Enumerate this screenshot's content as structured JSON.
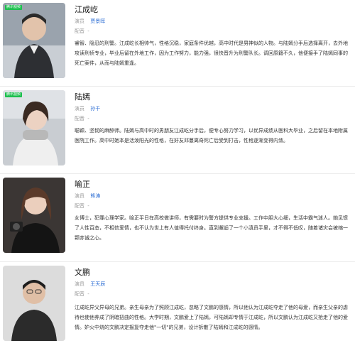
{
  "badge_label": "腾讯视频",
  "characters": [
    {
      "name": "江成屹",
      "actor_label": "演员",
      "actor": "贾景晖",
      "dub_label": "配音",
      "dub": "-",
      "description": "睿智、隐忍的刑警。江成屹长相帅气，性格沉稳，家庭条件优越，高中时代是男神似的人物。与陆嫣分手后选择离开，去外地攻读刑侦专业，毕业后留在外地工作，因为工作努力，能力强，很快晋升为刑警队长。调回原籍不久，他便接手了陆嫣同事的死亡案件，从而与陆嫣重逢。"
    },
    {
      "name": "陆嫣",
      "actor_label": "演员",
      "actor": "孙千",
      "dub_label": "配音",
      "dub": "-",
      "description": "聪颖、坚韧的麻醉师。陆嫣与高中时的男朋友江成屹分手后，便专心努力学习，以优异成绩从医科大毕业，之后留在本地附属医院工作。高中时她本是活泼阳光的性格，在好友邓蔓离奇死亡后受到打击，性格逐渐变得内敛。"
    },
    {
      "name": "喻正",
      "actor_label": "演员",
      "actor": "熊涛",
      "dub_label": "配音",
      "dub": "-",
      "description": "女博士，犯罪心理学家。喻正平日在高校做讲师，有需要时为警方提供专业支援。工作中胆大心细，生活中霸气迷人。她见惯了人性百态，不相信爱情，也不认为世上有人值得托付终身。直到邂逅了一个小滇员手里，才不得不低叹，随着诸灾会被缩一颗赤诚之心。"
    },
    {
      "name": "文鹏",
      "actor_label": "演员",
      "actor": "王天辰",
      "dub_label": "配音",
      "dub": "-",
      "description": "江成屹异父异母的兄弟。亲生母亲为了照顾江成屹，忽略了文鹏的感情，所以他认为江成屹夺走了他的母爱，而亲生父亲的虐待也使他养成了阴暗扭曲的性格。大学时期，文鹏爱上了陆嫣，可陆嫣却专情于江成屹，所以文鹏认为江成屹又抢走了他的爱情。妒火中烧的文鹏决定报复夺走他\"一切\"的兄弟，设计拆散了陆嫣和江成屹的感情。"
    }
  ]
}
